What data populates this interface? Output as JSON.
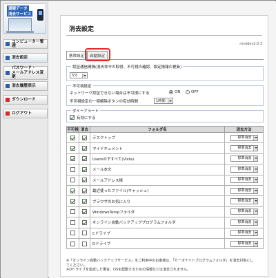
{
  "logo": {
    "line1": "通報データ",
    "line2": "消去サービス"
  },
  "sidebar": {
    "items": [
      {
        "label": "コンピューター管理",
        "color": "blue"
      },
      {
        "label": "消去設定",
        "color": "blue"
      },
      {
        "label": "パスワード・\nメールアドレス変更",
        "color": "blue"
      },
      {
        "label": "消去履歴表示",
        "color": "blue"
      },
      {
        "label": "ダウンロード",
        "color": "red"
      },
      {
        "label": "ログアウト",
        "color": "red"
      }
    ]
  },
  "page": {
    "title": "消去設定",
    "version": "rmsldev2.0.3"
  },
  "tabs": [
    {
      "label": "携帯設定"
    },
    {
      "label": "自動設定"
    }
  ],
  "sections": {
    "check": {
      "legend": "認証通信間隔(消去命令の取得、不可視の確認、設定情報の更新)",
      "interval_value": "5分"
    },
    "invisible": {
      "legend": "不可視設定",
      "network_label": "ネットワーク認証できない場合は不可視にする",
      "on_label": "ON",
      "off_label": "OFF",
      "on_selected": true,
      "release_label": "不可視設定の一時解除ボタンの有効時間",
      "release_value": "1時間"
    },
    "dummy": {
      "legend": "ダミーアラート",
      "enable_label": "有効にする",
      "enabled": true
    }
  },
  "table": {
    "headers": [
      "不可視",
      "消去",
      "フォルダ名",
      "消去方法"
    ],
    "rows": [
      {
        "invisible": true,
        "erase": true,
        "name": "デスクトップ",
        "method": "標準消去"
      },
      {
        "invisible": true,
        "erase": true,
        "name": "マイドキュメント",
        "method": "標準消去"
      },
      {
        "invisible": true,
        "erase": true,
        "name": "Usersの下すべて(Vista)",
        "method": "標準消去"
      },
      {
        "invisible": false,
        "erase": true,
        "name": "メール本文",
        "method": "標準消去"
      },
      {
        "invisible": false,
        "erase": true,
        "name": "メールアドレス帳",
        "method": "標準消去"
      },
      {
        "invisible": true,
        "erase": true,
        "name": "最近使ったファイル(キャッシュ)",
        "method": "標準消去"
      },
      {
        "invisible": true,
        "erase": true,
        "name": "ブラウザのお気に入り",
        "method": "標準消去"
      },
      {
        "invisible": false,
        "erase": true,
        "name": "WindowsTempフォルダ",
        "method": "標準消去"
      },
      {
        "invisible": false,
        "erase": true,
        "name": "オンライン自動バックアッププログラムフォルダ",
        "method": "標準消去"
      },
      {
        "invisible": false,
        "erase": false,
        "name": "Cドライブ",
        "method": "標準消去"
      },
      {
        "invisible": false,
        "erase": false,
        "name": "Dドライブ",
        "method": "標準消去"
      }
    ]
  },
  "notes": [
    "※「オンライン自動バックアップサービス」をご利用中のお客様は、「カーボナイトプログラムフォルダ」を消去対象にしてください。",
    "※Dドライブを指定した場合、OSを起動するための情報などは消去されません。"
  ]
}
